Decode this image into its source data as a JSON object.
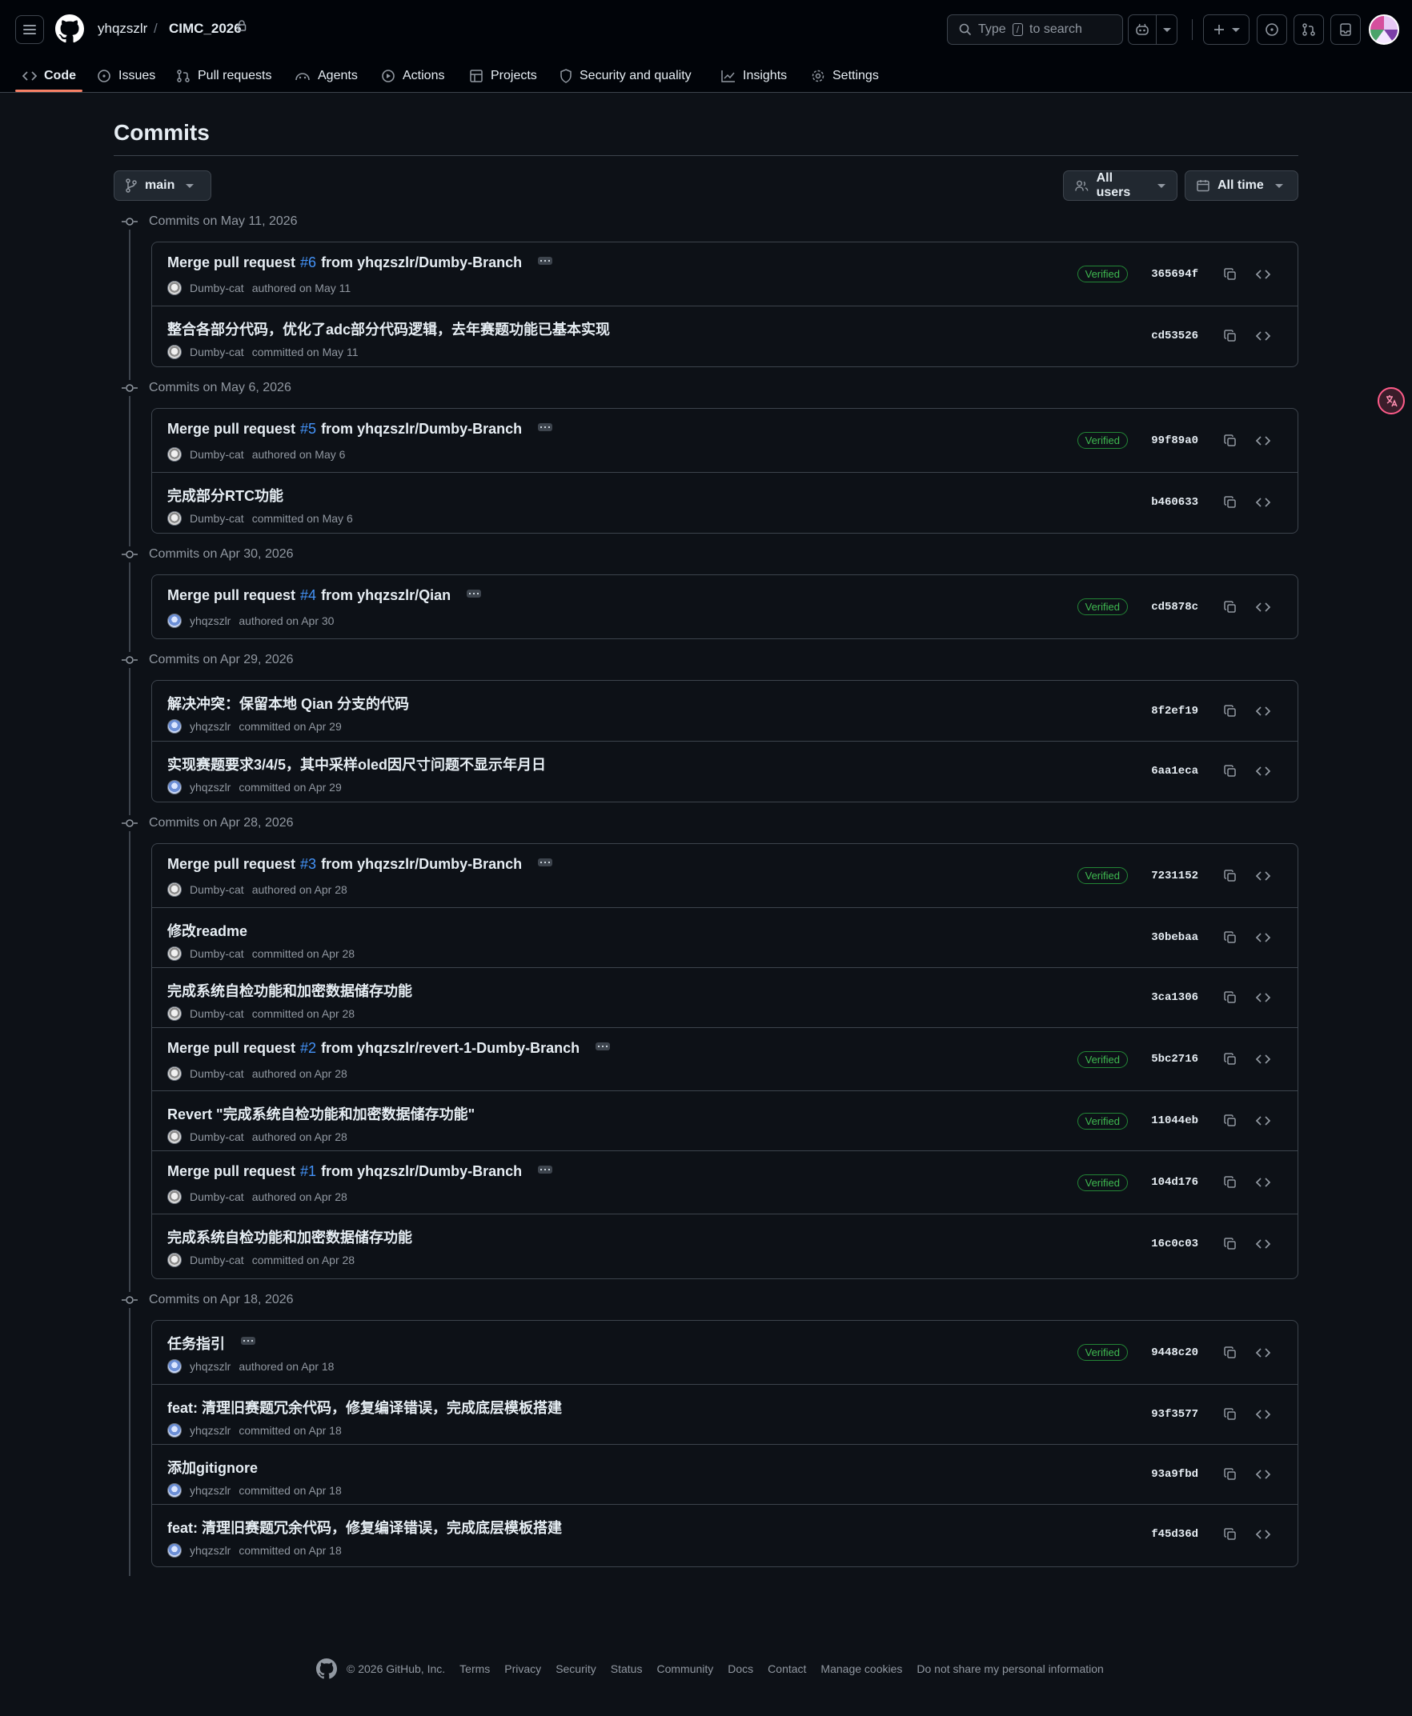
{
  "header": {
    "owner": "yhqzszlr",
    "separator": "/",
    "repo": "CIMC_2026",
    "search_prefix": "Type",
    "search_key": "/",
    "search_suffix": "to search"
  },
  "nav": [
    {
      "label": "Code",
      "icon": "code-icon"
    },
    {
      "label": "Issues",
      "icon": "issue-opened-icon"
    },
    {
      "label": "Pull requests",
      "icon": "git-pull-request-icon"
    },
    {
      "label": "Agents",
      "icon": "agent-icon"
    },
    {
      "label": "Actions",
      "icon": "play-icon"
    },
    {
      "label": "Projects",
      "icon": "table-icon"
    },
    {
      "label": "Security and quality",
      "icon": "shield-icon"
    },
    {
      "label": "Insights",
      "icon": "graph-icon"
    },
    {
      "label": "Settings",
      "icon": "gear-icon"
    }
  ],
  "main": {
    "title": "Commits",
    "branch": "main",
    "users_filter": "All users",
    "time_filter": "All time"
  },
  "verified_label": "Verified",
  "groups": [
    {
      "label": "Commits on May 11, 2026",
      "commits": [
        {
          "pre": "Merge pull request ",
          "pr": "#6",
          "post": " from yhqzszlr/Dumby-Branch",
          "ellipsis": true,
          "author": "Dumby-cat",
          "action": "authored on May 11",
          "verified": true,
          "sha": "365694f"
        },
        {
          "pre": "整合各部分代码，优化了adc部分代码逻辑，去年赛题功能已基本实现",
          "pr": "",
          "post": "",
          "ellipsis": false,
          "author": "Dumby-cat",
          "action": "committed on May 11",
          "verified": false,
          "sha": "cd53526"
        }
      ]
    },
    {
      "label": "Commits on May 6, 2026",
      "commits": [
        {
          "pre": "Merge pull request ",
          "pr": "#5",
          "post": " from yhqzszlr/Dumby-Branch",
          "ellipsis": true,
          "author": "Dumby-cat",
          "action": "authored on May 6",
          "verified": true,
          "sha": "99f89a0"
        },
        {
          "pre": "完成部分RTC功能",
          "pr": "",
          "post": "",
          "ellipsis": false,
          "author": "Dumby-cat",
          "action": "committed on May 6",
          "verified": false,
          "sha": "b460633"
        }
      ]
    },
    {
      "label": "Commits on Apr 30, 2026",
      "commits": [
        {
          "pre": "Merge pull request ",
          "pr": "#4",
          "post": " from yhqzszlr/Qian",
          "ellipsis": true,
          "author": "yhqzszlr",
          "action": "authored on Apr 30",
          "verified": true,
          "sha": "cd5878c"
        }
      ]
    },
    {
      "label": "Commits on Apr 29, 2026",
      "commits": [
        {
          "pre": "解决冲突：保留本地 Qian 分支的代码",
          "pr": "",
          "post": "",
          "ellipsis": false,
          "author": "yhqzszlr",
          "action": "committed on Apr 29",
          "verified": false,
          "sha": "8f2ef19"
        },
        {
          "pre": "实现赛题要求3/4/5，其中采样oled因尺寸问题不显示年月日",
          "pr": "",
          "post": "",
          "ellipsis": false,
          "author": "yhqzszlr",
          "action": "committed on Apr 29",
          "verified": false,
          "sha": "6aa1eca"
        }
      ]
    },
    {
      "label": "Commits on Apr 28, 2026",
      "commits": [
        {
          "pre": "Merge pull request ",
          "pr": "#3",
          "post": " from yhqzszlr/Dumby-Branch",
          "ellipsis": true,
          "author": "Dumby-cat",
          "action": "authored on Apr 28",
          "verified": true,
          "sha": "7231152"
        },
        {
          "pre": "修改readme",
          "pr": "",
          "post": "",
          "ellipsis": false,
          "author": "Dumby-cat",
          "action": "committed on Apr 28",
          "verified": false,
          "sha": "30bebaa"
        },
        {
          "pre": "完成系统自检功能和加密数据储存功能",
          "pr": "",
          "post": "",
          "ellipsis": false,
          "author": "Dumby-cat",
          "action": "committed on Apr 28",
          "verified": false,
          "sha": "3ca1306"
        },
        {
          "pre": "Merge pull request ",
          "pr": "#2",
          "post": " from yhqzszlr/revert-1-Dumby-Branch",
          "ellipsis": true,
          "author": "Dumby-cat",
          "action": "authored on Apr 28",
          "verified": true,
          "sha": "5bc2716"
        },
        {
          "pre": "Revert \"完成系统自检功能和加密数据储存功能\"",
          "pr": "",
          "post": "",
          "ellipsis": false,
          "author": "Dumby-cat",
          "action": "authored on Apr 28",
          "verified": true,
          "sha": "11044eb"
        },
        {
          "pre": "Merge pull request ",
          "pr": "#1",
          "post": " from yhqzszlr/Dumby-Branch",
          "ellipsis": true,
          "author": "Dumby-cat",
          "action": "authored on Apr 28",
          "verified": true,
          "sha": "104d176"
        },
        {
          "pre": "完成系统自检功能和加密数据储存功能",
          "pr": "",
          "post": "",
          "ellipsis": false,
          "author": "Dumby-cat",
          "action": "committed on Apr 28",
          "verified": false,
          "sha": "16c0c03"
        }
      ]
    },
    {
      "label": "Commits on Apr 18, 2026",
      "commits": [
        {
          "pre": "任务指引",
          "pr": "",
          "post": "",
          "ellipsis": true,
          "author": "yhqzszlr",
          "action": "authored on Apr 18",
          "verified": true,
          "sha": "9448c20"
        },
        {
          "pre": "feat: 清理旧赛题冗余代码，修复编译错误，完成底层模板搭建",
          "pr": "",
          "post": "",
          "ellipsis": false,
          "author": "yhqzszlr",
          "action": "committed on Apr 18",
          "verified": false,
          "sha": "93f3577"
        },
        {
          "pre": "添加gitignore",
          "pr": "",
          "post": "",
          "ellipsis": false,
          "author": "yhqzszlr",
          "action": "committed on Apr 18",
          "verified": false,
          "sha": "93a9fbd"
        },
        {
          "pre": "feat: 清理旧赛题冗余代码，修复编译错误，完成底层模板搭建",
          "pr": "",
          "post": "",
          "ellipsis": false,
          "author": "yhqzszlr",
          "action": "committed on Apr 18",
          "verified": false,
          "sha": "f45d36d"
        }
      ]
    }
  ],
  "footer": {
    "copyright": "© 2026 GitHub, Inc.",
    "links": [
      "Terms",
      "Privacy",
      "Security",
      "Status",
      "Community",
      "Docs",
      "Contact",
      "Manage cookies",
      "Do not share my personal information"
    ]
  },
  "colors": {
    "background": "#0d1117",
    "header": "#010409",
    "border": "#3d444d",
    "link": "#4493f8",
    "verified": "#3fb950",
    "active_tab": "#f78166"
  }
}
